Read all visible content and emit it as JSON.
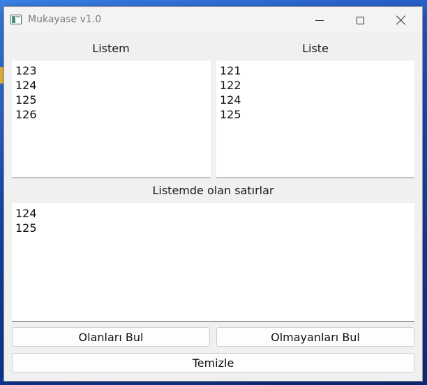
{
  "window": {
    "title": "Mukayase v1.0"
  },
  "panels": {
    "left": {
      "label": "Listem",
      "lines": [
        "123",
        "124",
        "125",
        "126"
      ]
    },
    "right": {
      "label": "Liste",
      "lines": [
        "121",
        "122",
        "124",
        "125"
      ]
    },
    "result": {
      "label": "Listemde olan satırlar",
      "lines": [
        "124",
        "125"
      ]
    }
  },
  "buttons": {
    "find_present": "Olanları Bul",
    "find_absent": "Olmayanları Bul",
    "clear": "Temizle"
  }
}
